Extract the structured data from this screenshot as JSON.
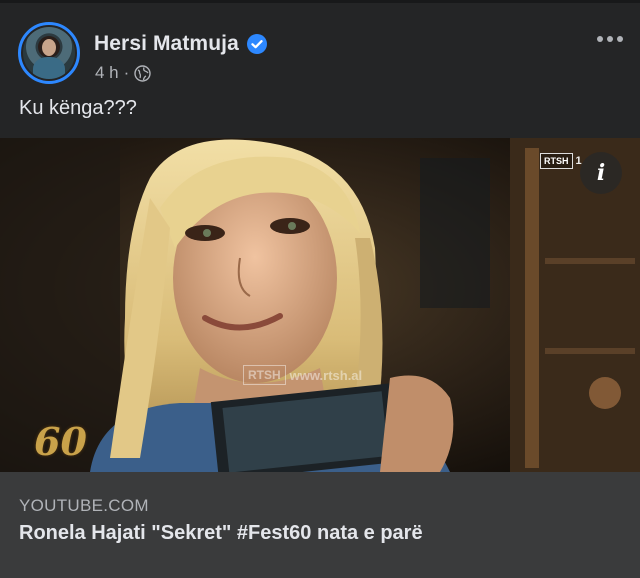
{
  "post": {
    "author": "Hersi Matmuja",
    "time": "4 h",
    "separator": "·",
    "text": "Ku kënga???"
  },
  "media": {
    "corner_logo": "RTSH",
    "corner_extra": "1",
    "watermark_logo": "RTSH",
    "watermark_url": "www.rtsh.al",
    "fest_logo": "60",
    "info_label": "i"
  },
  "link": {
    "domain": "YOUTUBE.COM",
    "title": "Ronela Hajati \"Sekret\" #Fest60 nata e parë"
  },
  "colors": {
    "background": "#242526",
    "card": "#3a3b3c",
    "accent": "#2d88ff",
    "secondary_text": "#b0b3b8"
  },
  "icons": [
    "verified-badge-icon",
    "globe-icon",
    "more-options-icon",
    "info-icon"
  ]
}
